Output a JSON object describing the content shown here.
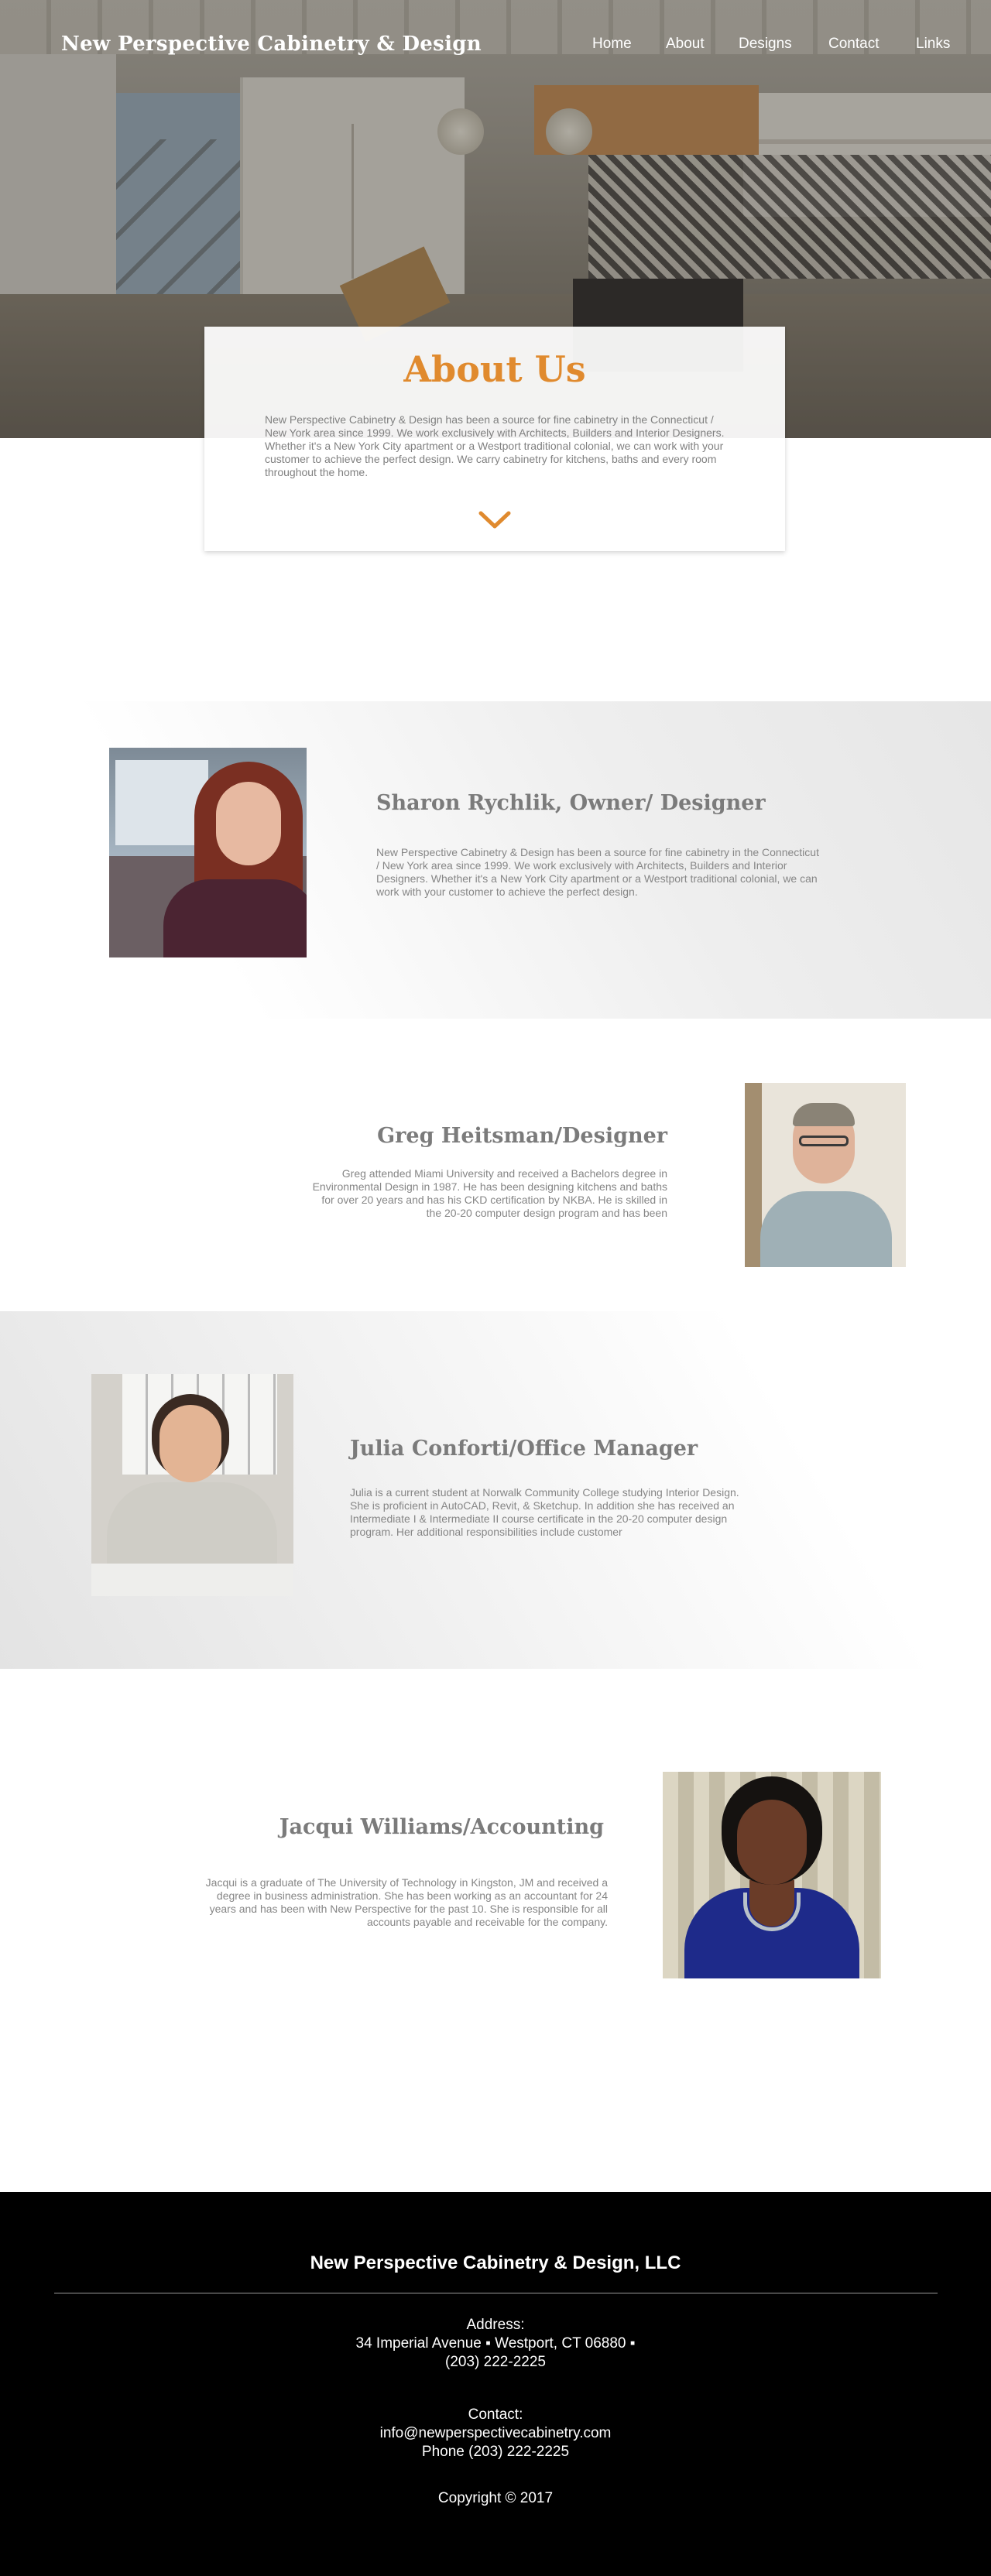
{
  "header": {
    "brand": "New Perspective Cabinetry & Design",
    "nav": [
      "Home",
      "About",
      "Designs",
      "Contact",
      "Links"
    ]
  },
  "about": {
    "title": "About Us",
    "text": "New Perspective Cabinetry & Design has been a source for fine cabinetry in the Connecticut / New York area since 1999. We work exclusively with Architects, Builders and Interior Designers. Whether it's a New York City apartment or a Westport traditional colonial, we can work with your customer to achieve the perfect design. We carry cabinetry for kitchens, baths and every room throughout the home.",
    "chevron_icon": "chevron-down-icon",
    "accent_color": "#e08a2e"
  },
  "team": [
    {
      "name": "Sharon Rychlik, Owner/ Designer",
      "bio": "New Perspective Cabinetry & Design has been a source for fine cabinetry in the Connecticut / New York area since 1999. We work exclusively with Architects, Builders and Interior Designers. Whether it's a New York City apartment or a Westport traditional colonial, we can work with your customer to achieve the perfect design."
    },
    {
      "name": "Greg Heitsman/Designer",
      "bio": "Greg attended Miami University and received a Bachelors degree in Environmental Design in 1987. He has been designing kitchens and baths for over 20 years and has his CKD certification by NKBA. He is skilled in the 20-20 computer design program and has been"
    },
    {
      "name": "Julia Conforti/Office Manager",
      "bio": "Julia is a current student at Norwalk Community College studying Interior Design. She is proficient in AutoCAD, Revit, & Sketchup. In addition she has received an Intermediate I & Intermediate II course certificate in the 20-20 computer design program. Her additional responsibilities include customer"
    },
    {
      "name": "Jacqui Williams/Accounting",
      "bio": "Jacqui is a graduate of The University of Technology in Kingston, JM and received a degree in business administration. She has been working as an accountant for  24 years and has been with New Perspective for the past 10. She is responsible for all accounts payable and receivable for the company."
    }
  ],
  "footer": {
    "title": "New Perspective Cabinetry & Design, LLC",
    "address_label": "Address:",
    "address_line": "34 Imperial Avenue ▪ Westport, CT 06880 ▪",
    "address_phone": "(203) 222-2225",
    "contact_label": "Contact:",
    "email": "info@newperspectivecabinetry.com",
    "phone": "Phone (203) 222-2225",
    "copyright": "Copyright © 2017"
  }
}
